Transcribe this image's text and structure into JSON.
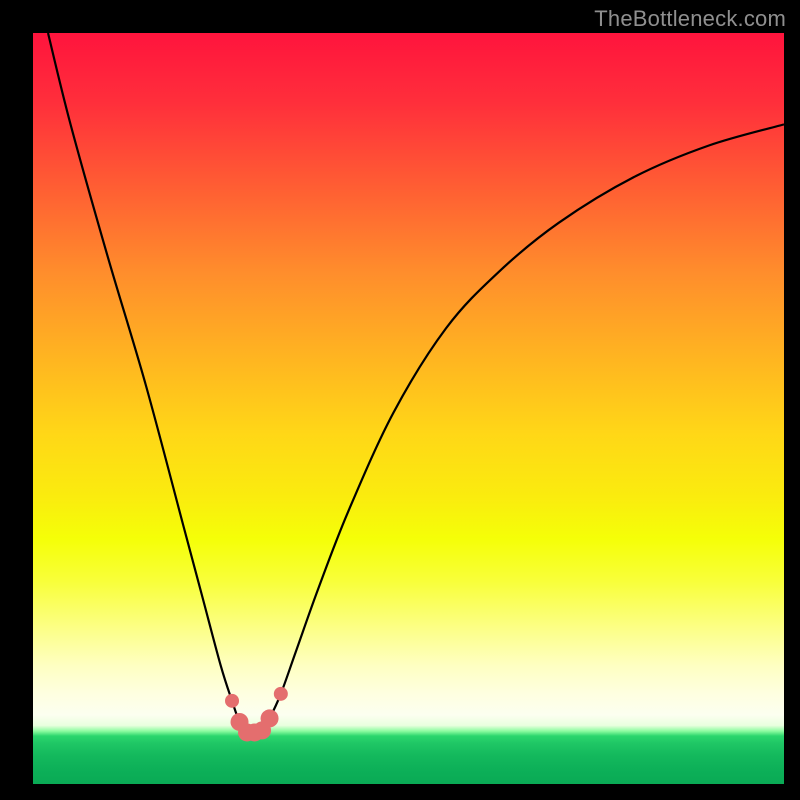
{
  "watermark": "TheBottleneck.com",
  "chart_data": {
    "type": "line",
    "title": "",
    "xlabel": "",
    "ylabel": "",
    "xlim": [
      0,
      100
    ],
    "ylim": [
      0,
      100
    ],
    "x": [
      2,
      5,
      10,
      15,
      20,
      22.5,
      25,
      26.5,
      27.5,
      28.5,
      29.5,
      30.5,
      31.5,
      33,
      35,
      38,
      42,
      48,
      55,
      62,
      70,
      80,
      90,
      100
    ],
    "values": [
      100,
      87,
      68,
      50,
      30,
      20,
      10,
      5,
      2,
      0.5,
      0.5,
      0.8,
      2.5,
      6,
      12,
      21,
      32,
      46,
      58,
      66,
      73,
      79.5,
      84,
      87
    ],
    "markers": {
      "x": [
        26.5,
        27.5,
        28.5,
        29.5,
        30.5,
        31.5,
        33
      ],
      "y": [
        5,
        2,
        0.5,
        0.5,
        0.8,
        2.5,
        6
      ]
    },
    "notes": "V-shaped bottleneck curve on red-to-green vertical gradient. Minimum near x≈29 at y≈0. Values are rough estimates read from an unlabeled plot; axes are 0–100 conceptual ranges."
  }
}
